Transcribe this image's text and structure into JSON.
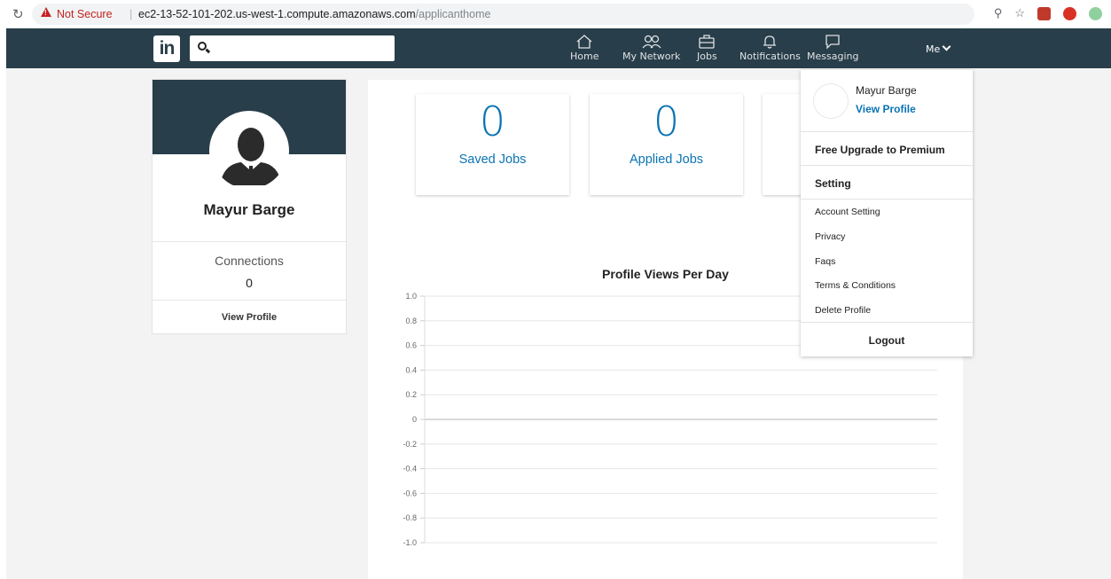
{
  "browser": {
    "security_label": "Not Secure",
    "separator": "|",
    "url_host": "ec2-13-52-101-202.us-west-1.compute.amazonaws.com",
    "url_path": "/applicanthome"
  },
  "nav": {
    "logo": "in",
    "search_placeholder": "",
    "items": [
      {
        "label": "Home",
        "icon": "home-icon"
      },
      {
        "label": "My Network",
        "icon": "network-icon"
      },
      {
        "label": "Jobs",
        "icon": "briefcase-icon"
      },
      {
        "label": "Notifications",
        "icon": "bell-icon"
      },
      {
        "label": "Messaging",
        "icon": "message-icon"
      }
    ],
    "me_label": "Me"
  },
  "profile_card": {
    "name": "Mayur Barge",
    "connections_label": "Connections",
    "connections_count": "0",
    "view_profile": "View Profile"
  },
  "stats": [
    {
      "value": "0",
      "label": "Saved Jobs"
    },
    {
      "value": "0",
      "label": "Applied Jobs"
    }
  ],
  "chart_title": "Profile Views Per Day",
  "chart_data": {
    "type": "line",
    "title": "Profile Views Per Day",
    "xlabel": "",
    "ylabel": "",
    "ylim": [
      -1.0,
      1.0
    ],
    "yticks": [
      "1.0",
      "0.8",
      "0.6",
      "0.4",
      "0.2",
      "0",
      "-0.2",
      "-0.4",
      "-0.6",
      "-0.8",
      "-1.0"
    ],
    "series": [],
    "grid": true
  },
  "dropdown": {
    "name": "Mayur Barge",
    "view_profile": "View Profile",
    "premium": "Free Upgrade to Premium",
    "setting_header": "Setting",
    "items": [
      "Account Setting",
      "Privacy",
      "Faqs",
      "Terms & Conditions",
      "Delete Profile"
    ],
    "logout": "Logout"
  },
  "colors": {
    "nav_bg": "#283e4a",
    "accent": "#0a73b3"
  }
}
